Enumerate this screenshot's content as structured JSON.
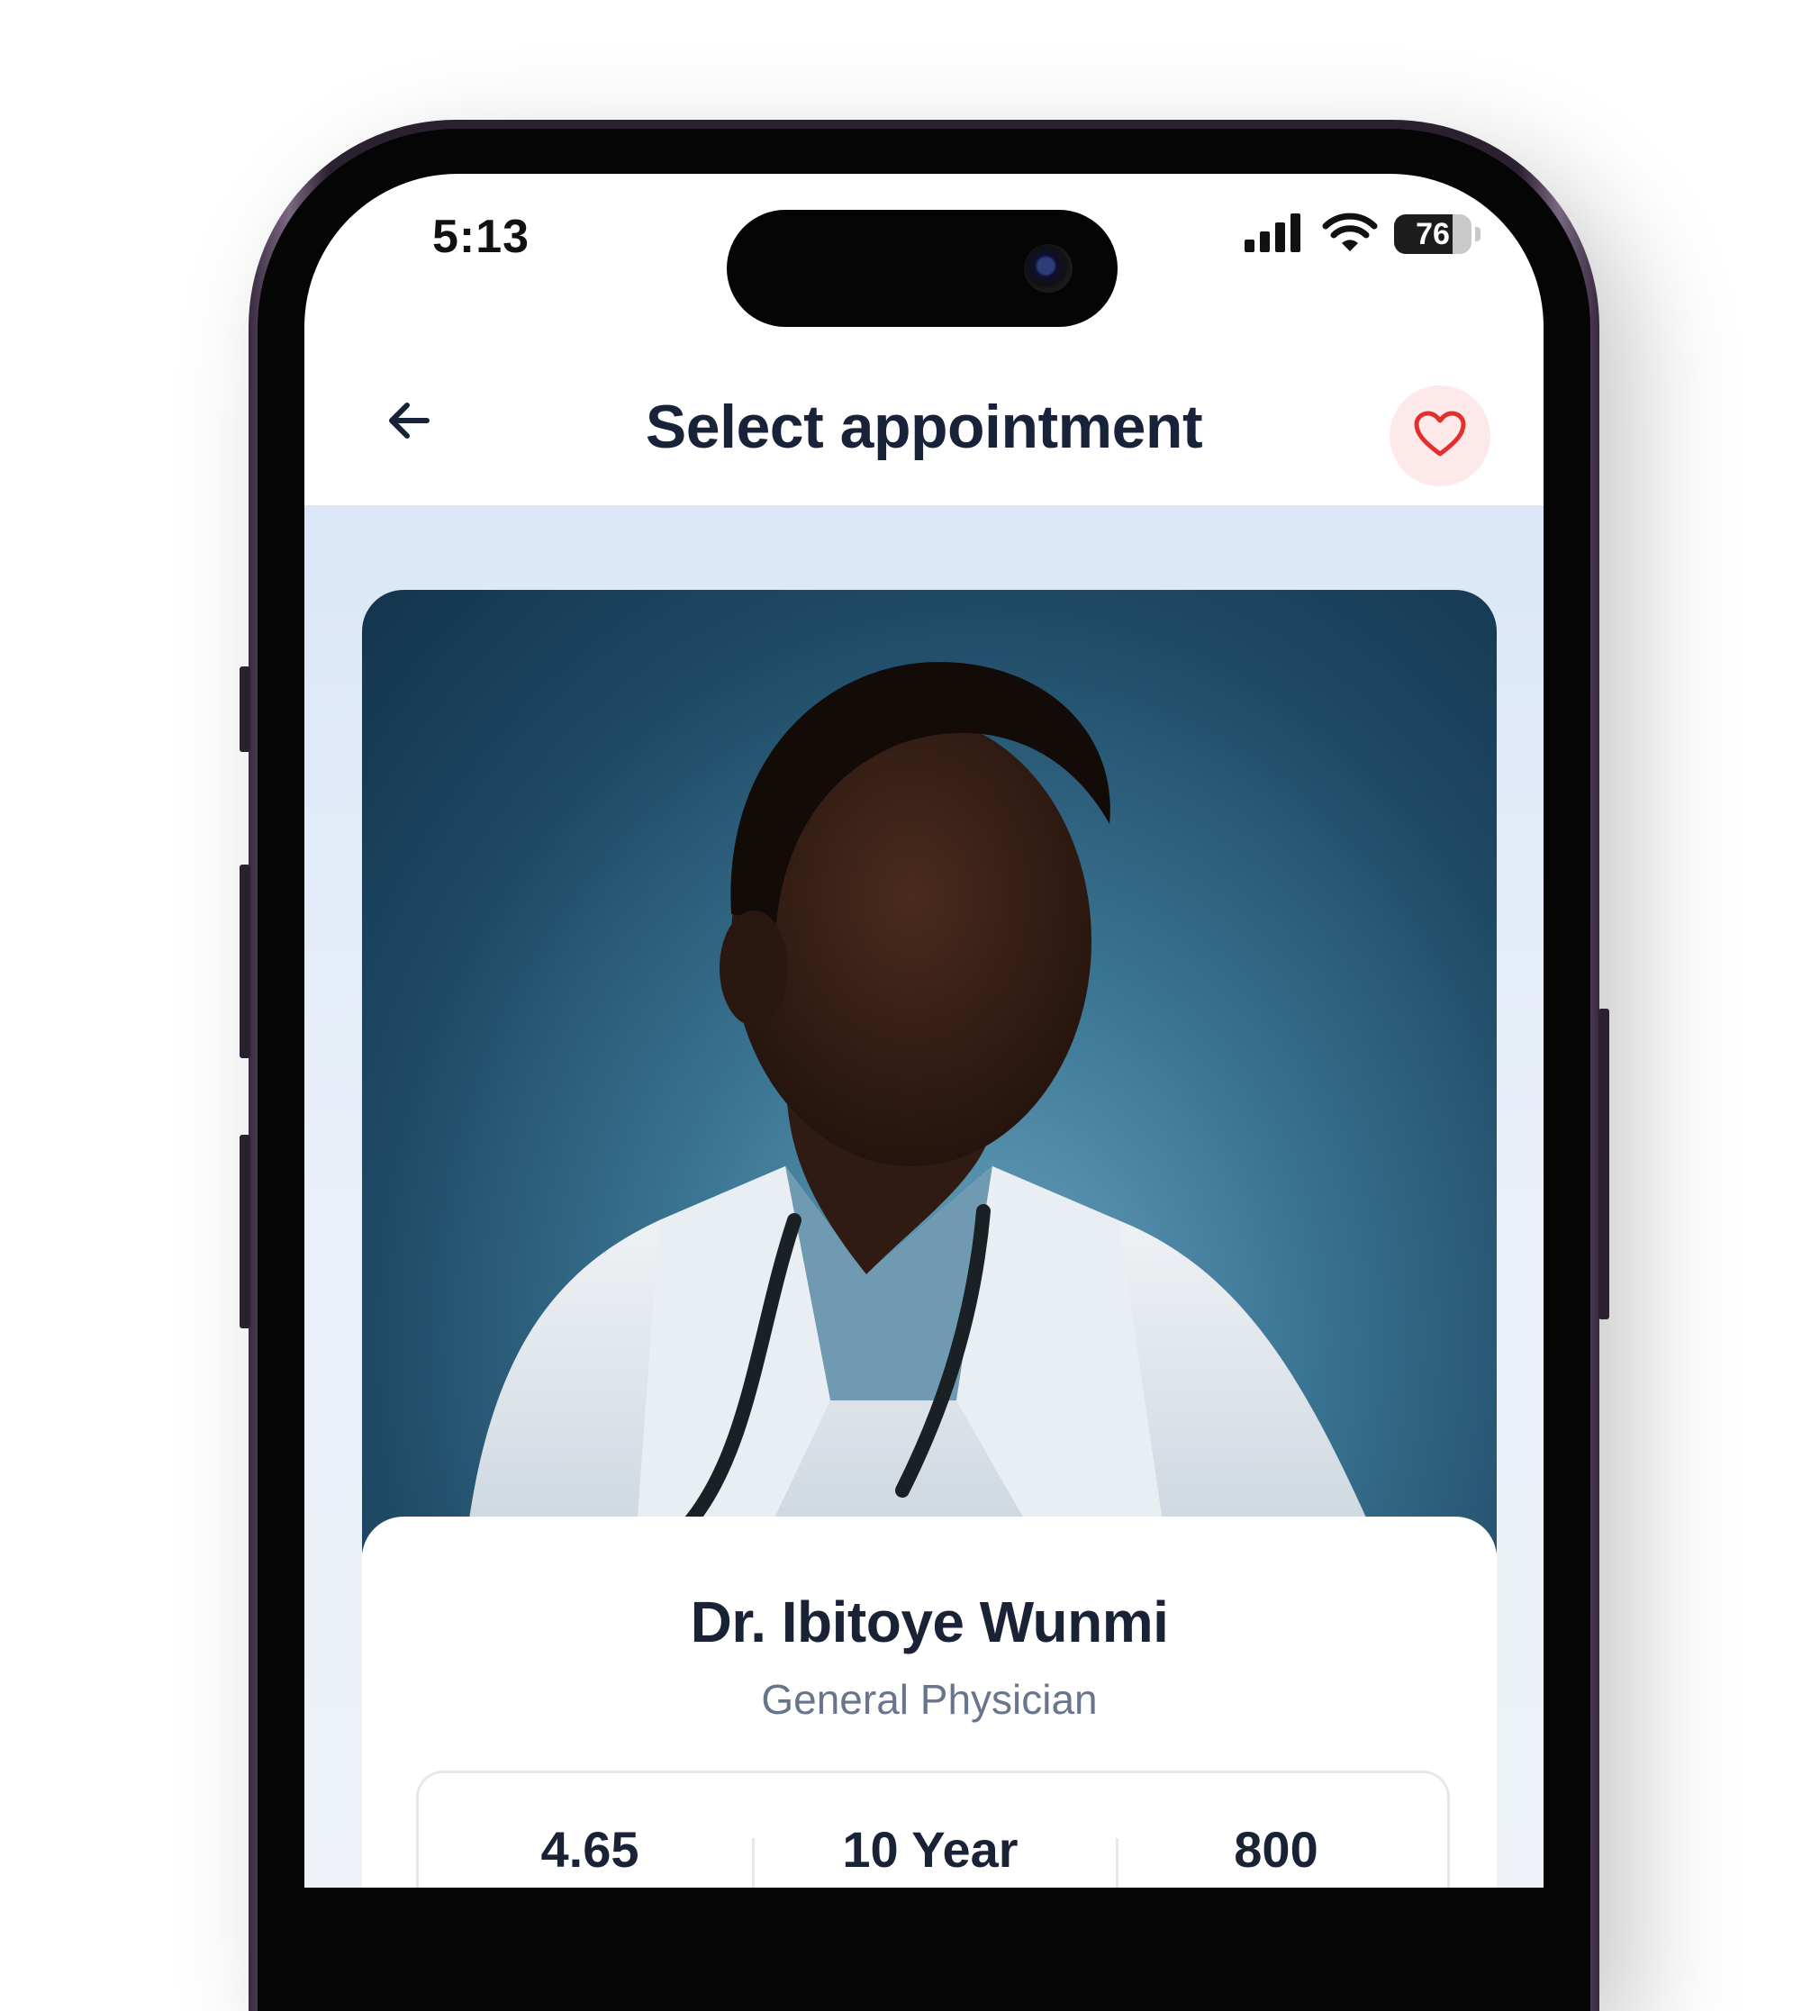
{
  "status_bar": {
    "time": "5:13",
    "battery": 76,
    "icons": [
      "signal-icon",
      "wifi-icon",
      "battery-icon"
    ]
  },
  "header": {
    "back_icon": "arrow-left-icon",
    "title": "Select appointment",
    "favorite_icon": "heart-icon"
  },
  "doctor": {
    "name": "Dr. Ibitoye Wunmi",
    "specialty": "General Physician",
    "stats": [
      {
        "value": "4.65"
      },
      {
        "value": "10 Year"
      },
      {
        "value": "800"
      }
    ]
  },
  "colors": {
    "title": "#18233a",
    "favorite_bg": "#fde9ea",
    "favorite_heart": "#e0312f",
    "content_bg": "#dbe7f7",
    "specialty_text": "#68758a"
  }
}
